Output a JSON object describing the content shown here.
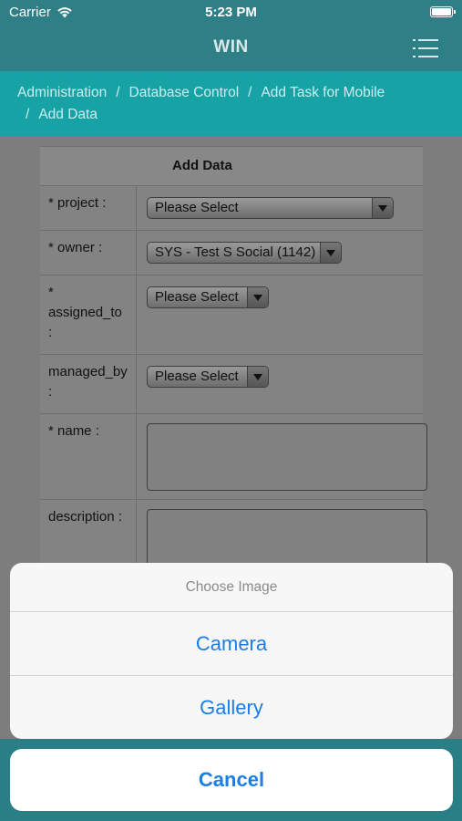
{
  "status_bar": {
    "carrier": "Carrier",
    "time": "5:23 PM"
  },
  "nav": {
    "title": "WIN"
  },
  "breadcrumb": {
    "items": [
      "Administration",
      "Database Control",
      "Add Task for Mobile",
      "Add Data"
    ],
    "separator": "/"
  },
  "form": {
    "header": "Add Data",
    "project_label": "* project :",
    "project_value": "Please Select",
    "owner_label": "* owner :",
    "owner_value": "SYS - Test S Social (1142)",
    "assigned_label_1": "*",
    "assigned_label_2": "assigned_to",
    "assigned_label_3": ":",
    "assigned_value": "Please Select",
    "managed_label_1": "managed_by",
    "managed_label_2": ":",
    "managed_value": "Please Select",
    "name_label": "* name :",
    "description_label": "description :"
  },
  "action_sheet": {
    "title": "Choose Image",
    "options": [
      "Camera",
      "Gallery"
    ],
    "cancel": "Cancel"
  },
  "colors": {
    "nav_bg": "#2f7f87",
    "breadcrumb_bg": "#17a2a6",
    "action_blue": "#1a7ee6"
  }
}
